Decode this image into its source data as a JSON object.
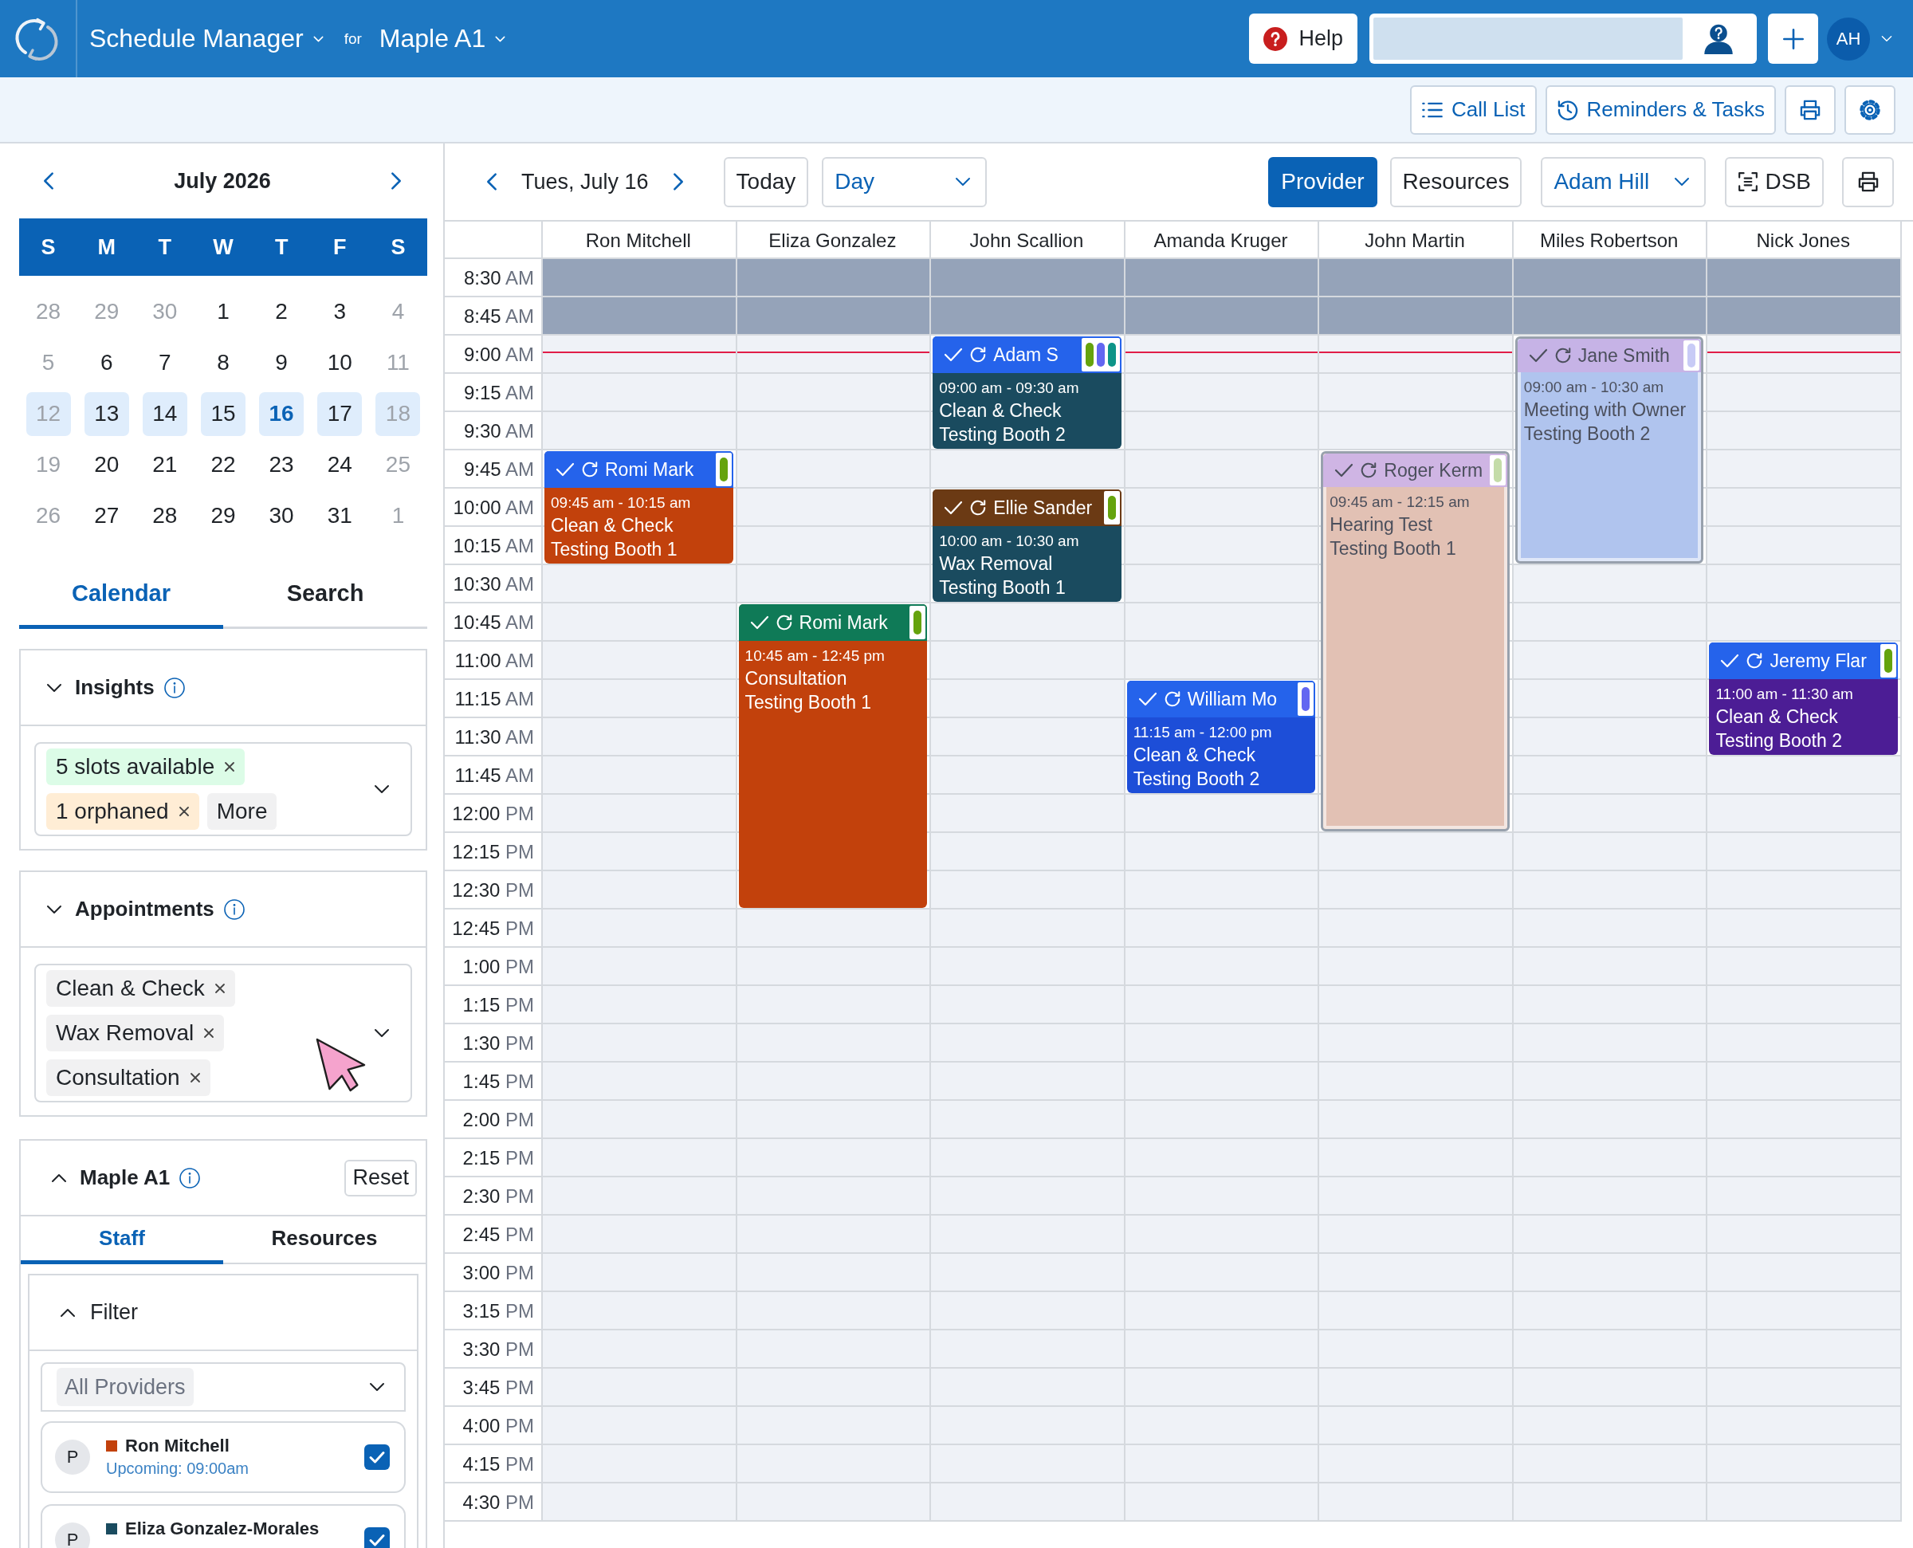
{
  "app_bar": {
    "title": "Schedule Manager",
    "for_label": "for",
    "location": "Maple A1",
    "help_label": "Help",
    "avatar": "AH"
  },
  "toolbar": {
    "buttons": [
      {
        "kind": "list",
        "label": "Call List"
      },
      {
        "kind": "reminders",
        "label": "Reminders & Tasks"
      },
      {
        "kind": "print"
      },
      {
        "kind": "settings"
      }
    ]
  },
  "mini_calendar": {
    "month": "July 2026",
    "weekdays": [
      "S",
      "M",
      "T",
      "W",
      "T",
      "F",
      "S"
    ],
    "weeks": [
      {
        "highlighted": false,
        "days": [
          {
            "label": "28",
            "muted": true,
            "selected": false
          },
          {
            "label": "29",
            "muted": true,
            "selected": false
          },
          {
            "label": "30",
            "muted": true,
            "selected": false
          },
          {
            "label": "1",
            "muted": false,
            "selected": false
          },
          {
            "label": "2",
            "muted": false,
            "selected": false
          },
          {
            "label": "3",
            "muted": false,
            "selected": false
          },
          {
            "label": "4",
            "muted": true,
            "selected": false
          }
        ]
      },
      {
        "highlighted": false,
        "days": [
          {
            "label": "5",
            "muted": true,
            "selected": false
          },
          {
            "label": "6",
            "muted": false,
            "selected": false
          },
          {
            "label": "7",
            "muted": false,
            "selected": false
          },
          {
            "label": "8",
            "muted": false,
            "selected": false
          },
          {
            "label": "9",
            "muted": false,
            "selected": false
          },
          {
            "label": "10",
            "muted": false,
            "selected": false
          },
          {
            "label": "11",
            "muted": true,
            "selected": false
          }
        ]
      },
      {
        "highlighted": true,
        "days": [
          {
            "label": "12",
            "muted": true,
            "selected": false
          },
          {
            "label": "13",
            "muted": false,
            "selected": false
          },
          {
            "label": "14",
            "muted": false,
            "selected": false
          },
          {
            "label": "15",
            "muted": false,
            "selected": false
          },
          {
            "label": "16",
            "muted": false,
            "selected": true
          },
          {
            "label": "17",
            "muted": false,
            "selected": false
          },
          {
            "label": "18",
            "muted": true,
            "selected": false
          }
        ]
      },
      {
        "highlighted": false,
        "days": [
          {
            "label": "19",
            "muted": true,
            "selected": false
          },
          {
            "label": "20",
            "muted": false,
            "selected": false
          },
          {
            "label": "21",
            "muted": false,
            "selected": false
          },
          {
            "label": "22",
            "muted": false,
            "selected": false
          },
          {
            "label": "23",
            "muted": false,
            "selected": false
          },
          {
            "label": "24",
            "muted": false,
            "selected": false
          },
          {
            "label": "25",
            "muted": true,
            "selected": false
          }
        ]
      },
      {
        "highlighted": false,
        "days": [
          {
            "label": "26",
            "muted": true,
            "selected": false
          },
          {
            "label": "27",
            "muted": false,
            "selected": false
          },
          {
            "label": "28",
            "muted": false,
            "selected": false
          },
          {
            "label": "29",
            "muted": false,
            "selected": false
          },
          {
            "label": "30",
            "muted": false,
            "selected": false
          },
          {
            "label": "31",
            "muted": false,
            "selected": false
          },
          {
            "label": "1",
            "muted": true,
            "selected": false
          }
        ]
      }
    ]
  },
  "sidebar_tabs": [
    {
      "label": "Calendar",
      "selected": true
    },
    {
      "label": "Search",
      "selected": false
    }
  ],
  "insights": {
    "title": "Insights",
    "tags": [
      {
        "label": "5 slots available",
        "color": "#dcfce7",
        "removable": true
      },
      {
        "label": "1 orphaned",
        "color": "#ffedd5",
        "removable": true
      },
      {
        "label": "More",
        "color": "#f1f1f2",
        "removable": false
      }
    ]
  },
  "appointment_filter": {
    "title": "Appointments",
    "tags": [
      {
        "label": "Clean & Check",
        "color": "#f1f1f2",
        "removable": true
      },
      {
        "label": "Wax Removal",
        "color": "#f1f1f2",
        "removable": true
      },
      {
        "label": "Consultation",
        "color": "#f1f1f2",
        "removable": true
      }
    ]
  },
  "location_panel": {
    "title": "Maple A1",
    "reset": "Reset",
    "tabs": [
      {
        "label": "Staff",
        "selected": true
      },
      {
        "label": "Resources",
        "selected": false
      }
    ],
    "filter": {
      "title": "Filter",
      "value": "All Providers"
    },
    "providers": [
      {
        "initial": "P",
        "name": "Ron Mitchell",
        "color": "#c2410c",
        "note": "Upcoming: 09:00am",
        "checked": true
      },
      {
        "initial": "P",
        "name": "Eliza Gonzalez-Morales",
        "color": "#1a4b5f",
        "checked": true
      }
    ]
  },
  "schedule": {
    "date": "Tues, July 16",
    "today": "Today",
    "view": "Day",
    "modes": [
      {
        "label": "Provider",
        "selected": true
      },
      {
        "label": "Resources",
        "selected": false
      }
    ],
    "user": "Adam Hill",
    "dsb": "DSB",
    "times": [
      {
        "time": "8:30",
        "period": "AM",
        "blocked": true,
        "current": false
      },
      {
        "time": "8:45",
        "period": "AM",
        "blocked": true,
        "current": false
      },
      {
        "time": "9:00",
        "period": "AM",
        "blocked": false,
        "current": true
      },
      {
        "time": "9:15",
        "period": "AM",
        "blocked": false,
        "current": false
      },
      {
        "time": "9:30",
        "period": "AM",
        "blocked": false,
        "current": false
      },
      {
        "time": "9:45",
        "period": "AM",
        "blocked": false,
        "current": false
      },
      {
        "time": "10:00",
        "period": "AM",
        "blocked": false,
        "current": false
      },
      {
        "time": "10:15",
        "period": "AM",
        "blocked": false,
        "current": false
      },
      {
        "time": "10:30",
        "period": "AM",
        "blocked": false,
        "current": false
      },
      {
        "time": "10:45",
        "period": "AM",
        "blocked": false,
        "current": false
      },
      {
        "time": "11:00",
        "period": "AM",
        "blocked": false,
        "current": false
      },
      {
        "time": "11:15",
        "period": "AM",
        "blocked": false,
        "current": false
      },
      {
        "time": "11:30",
        "period": "AM",
        "blocked": false,
        "current": false
      },
      {
        "time": "11:45",
        "period": "AM",
        "blocked": false,
        "current": false
      },
      {
        "time": "12:00",
        "period": "PM",
        "blocked": false,
        "current": false
      },
      {
        "time": "12:15",
        "period": "PM",
        "blocked": false,
        "current": false
      },
      {
        "time": "12:30",
        "period": "PM",
        "blocked": false,
        "current": false
      },
      {
        "time": "12:45",
        "period": "PM",
        "blocked": false,
        "current": false
      },
      {
        "time": "1:00",
        "period": "PM",
        "blocked": false,
        "current": false
      },
      {
        "time": "1:15",
        "period": "PM",
        "blocked": false,
        "current": false
      },
      {
        "time": "1:30",
        "period": "PM",
        "blocked": false,
        "current": false
      },
      {
        "time": "1:45",
        "period": "PM",
        "blocked": false,
        "current": false
      },
      {
        "time": "2:00",
        "period": "PM",
        "blocked": false,
        "current": false
      },
      {
        "time": "2:15",
        "period": "PM",
        "blocked": false,
        "current": false
      },
      {
        "time": "2:30",
        "period": "PM",
        "blocked": false,
        "current": false
      },
      {
        "time": "2:45",
        "period": "PM",
        "blocked": false,
        "current": false
      },
      {
        "time": "3:00",
        "period": "PM",
        "blocked": false,
        "current": false
      },
      {
        "time": "3:15",
        "period": "PM",
        "blocked": false,
        "current": false
      },
      {
        "time": "3:30",
        "period": "PM",
        "blocked": false,
        "current": false
      },
      {
        "time": "3:45",
        "period": "PM",
        "blocked": false,
        "current": false
      },
      {
        "time": "4:00",
        "period": "PM",
        "blocked": false,
        "current": false
      },
      {
        "time": "4:15",
        "period": "PM",
        "blocked": false,
        "current": false
      },
      {
        "time": "4:30",
        "period": "PM",
        "blocked": false,
        "current": false
      }
    ],
    "columns": [
      {
        "name": "Ron Mitchell",
        "appointments": [
          {
            "header": {
              "patient": "Romi Mark",
              "color": "#2563eb",
              "pills": [
                {
                  "color": "#65a30d"
                }
              ]
            },
            "time": "09:45 am - 10:15 am",
            "service": "Clean & Check",
            "room": "Testing Booth 1",
            "color": "#c2410c",
            "dimmed": false
          }
        ]
      },
      {
        "name": "Eliza Gonzalez",
        "appointments": [
          {
            "header": {
              "patient": "Romi Mark",
              "color": "#0f7a57",
              "pills": [
                {
                  "color": "#65a30d"
                }
              ]
            },
            "time": "10:45 am - 12:45 pm",
            "service": "Consultation",
            "room": "Testing Booth 1",
            "color": "#c2410c",
            "dimmed": false
          }
        ]
      },
      {
        "name": "John Scallion",
        "appointments": [
          {
            "header": {
              "patient": "Adam S",
              "color": "#2563eb",
              "pills": [
                {
                  "color": "#65a30d"
                },
                {
                  "color": "#6366f1"
                },
                {
                  "color": "#0d9488"
                }
              ]
            },
            "time": "09:00 am - 09:30 am",
            "service": "Clean & Check",
            "room": "Testing Booth 2",
            "color": "#1a4b5f",
            "dimmed": false
          },
          {
            "header": {
              "patient": "Ellie Sander",
              "color": "#6b3a14",
              "pills": [
                {
                  "color": "#65a30d"
                }
              ]
            },
            "time": "10:00 am - 10:30 am",
            "service": "Wax Removal",
            "room": "Testing Booth 1",
            "color": "#1a4b5f",
            "dimmed": false
          }
        ]
      },
      {
        "name": "Amanda Kruger",
        "appointments": [
          {
            "header": {
              "patient": "William Mo",
              "color": "#2563eb",
              "pills": [
                {
                  "color": "#6366f1"
                }
              ]
            },
            "time": "11:15 am - 12:00 pm",
            "service": "Clean & Check",
            "room": "Testing Booth 2",
            "color": "#1d4ed8",
            "dimmed": false
          }
        ]
      },
      {
        "name": "John Martin",
        "appointments": [
          {
            "header": {
              "patient": "Roger Kerm",
              "color": "#cfb5e4",
              "pills": [
                {
                  "color": "#c4dca8"
                }
              ]
            },
            "time": "09:45 am - 12:15 am",
            "service": "Hearing Test",
            "room": "Testing Booth 1",
            "color": "#e2c1b4",
            "dimmed": true
          }
        ]
      },
      {
        "name": "Miles Robertson",
        "appointments": [
          {
            "header": {
              "patient": "Jane Smith",
              "color": "#c6b3e6",
              "pills": [
                {
                  "color": "#c8cbf6"
                }
              ]
            },
            "time": "09:00 am - 10:30 am",
            "service": "Meeting with Owner",
            "room": "Testing Booth 2",
            "color": "#b0c4ee",
            "dimmed": true
          }
        ]
      },
      {
        "name": "Nick Jones",
        "appointments": [
          {
            "header": {
              "patient": "Jeremy Flar",
              "color": "#2563eb",
              "pills": [
                {
                  "color": "#65a30d"
                }
              ]
            },
            "time": "11:00 am - 11:30 am",
            "service": "Clean & Check",
            "room": "Testing Booth 2",
            "color": "#4c1d95",
            "dimmed": false
          }
        ]
      }
    ]
  }
}
